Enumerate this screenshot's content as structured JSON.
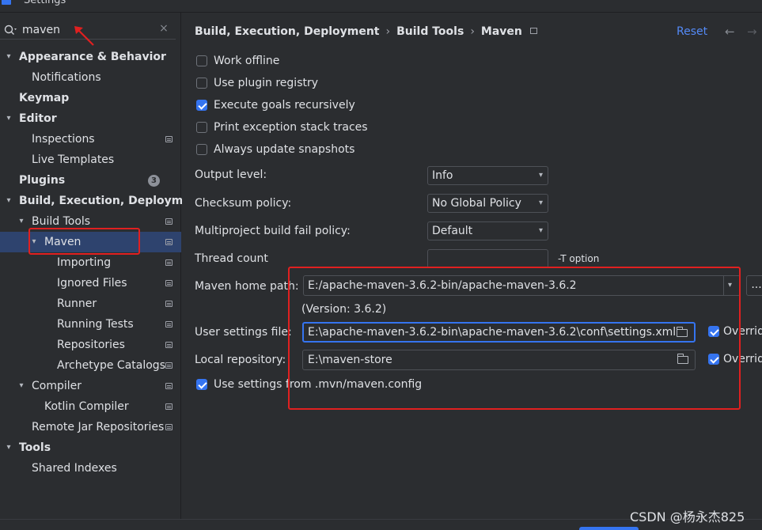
{
  "window": {
    "title": "Settings"
  },
  "search": {
    "value": "maven",
    "icon": "search-icon",
    "clear_icon": "close-icon"
  },
  "tree": [
    {
      "label": "Appearance & Behavior",
      "bold": true,
      "level": 0,
      "arrow": "down"
    },
    {
      "label": "Notifications",
      "bold": false,
      "level": 1
    },
    {
      "label": "Keymap",
      "bold": true,
      "level": 0
    },
    {
      "label": "Editor",
      "bold": true,
      "level": 0,
      "arrow": "down"
    },
    {
      "label": "Inspections",
      "bold": false,
      "level": 1,
      "page": true
    },
    {
      "label": "Live Templates",
      "bold": false,
      "level": 1
    },
    {
      "label": "Plugins",
      "bold": true,
      "level": 0,
      "badge": "3"
    },
    {
      "label": "Build, Execution, Deployment",
      "bold": true,
      "level": 0,
      "arrow": "down"
    },
    {
      "label": "Build Tools",
      "bold": false,
      "level": 1,
      "arrow": "down",
      "page": true
    },
    {
      "label": "Maven",
      "bold": false,
      "level": 2,
      "arrow": "down",
      "page": true,
      "selected": true
    },
    {
      "label": "Importing",
      "bold": false,
      "level": 3,
      "page": true
    },
    {
      "label": "Ignored Files",
      "bold": false,
      "level": 3,
      "page": true
    },
    {
      "label": "Runner",
      "bold": false,
      "level": 3,
      "page": true
    },
    {
      "label": "Running Tests",
      "bold": false,
      "level": 3,
      "page": true
    },
    {
      "label": "Repositories",
      "bold": false,
      "level": 3,
      "page": true
    },
    {
      "label": "Archetype Catalogs",
      "bold": false,
      "level": 3,
      "page": true
    },
    {
      "label": "Compiler",
      "bold": false,
      "level": 1,
      "arrow": "down",
      "page": true
    },
    {
      "label": "Kotlin Compiler",
      "bold": false,
      "level": 2,
      "page": true
    },
    {
      "label": "Remote Jar Repositories",
      "bold": false,
      "level": 1,
      "page": true
    },
    {
      "label": "Tools",
      "bold": true,
      "level": 0,
      "arrow": "down"
    },
    {
      "label": "Shared Indexes",
      "bold": false,
      "level": 1
    }
  ],
  "header": {
    "crumbs": [
      "Build, Execution, Deployment",
      "Build Tools",
      "Maven"
    ],
    "reset": "Reset",
    "back_icon": "arrow-left-icon",
    "forward_icon": "arrow-right-icon"
  },
  "options": [
    {
      "label": "Work offline",
      "checked": false
    },
    {
      "label": "Use plugin registry",
      "checked": false
    },
    {
      "label": "Execute goals recursively",
      "checked": true
    },
    {
      "label": "Print exception stack traces",
      "checked": false
    },
    {
      "label": "Always update snapshots",
      "checked": false
    }
  ],
  "fields": {
    "output_level": {
      "label": "Output level:",
      "value": "Info"
    },
    "checksum": {
      "label": "Checksum policy:",
      "value": "No Global Policy"
    },
    "fail_policy": {
      "label": "Multiproject build fail policy:",
      "value": "Default"
    },
    "thread_count": {
      "label": "Thread count",
      "value": "",
      "hint": "-T option"
    },
    "maven_home": {
      "label": "Maven home path:",
      "value": "E:/apache-maven-3.6.2-bin/apache-maven-3.6.2",
      "more": "..."
    },
    "version": "(Version: 3.6.2)",
    "user_settings": {
      "label": "User settings file:",
      "value": "E:\\apache-maven-3.6.2-bin\\apache-maven-3.6.2\\conf\\settings.xml",
      "override_label": "Override",
      "override_checked": true
    },
    "local_repo": {
      "label": "Local repository:",
      "value": "E:\\maven-store",
      "override_label": "Override",
      "override_checked": true
    },
    "mvn_config": {
      "label": "Use settings from .mvn/maven.config",
      "checked": true
    }
  },
  "watermark": "CSDN @杨永杰825",
  "colors": {
    "accent": "#3574f0",
    "link": "#548af7",
    "annotation": "#e02020",
    "selection": "#2e436e"
  }
}
